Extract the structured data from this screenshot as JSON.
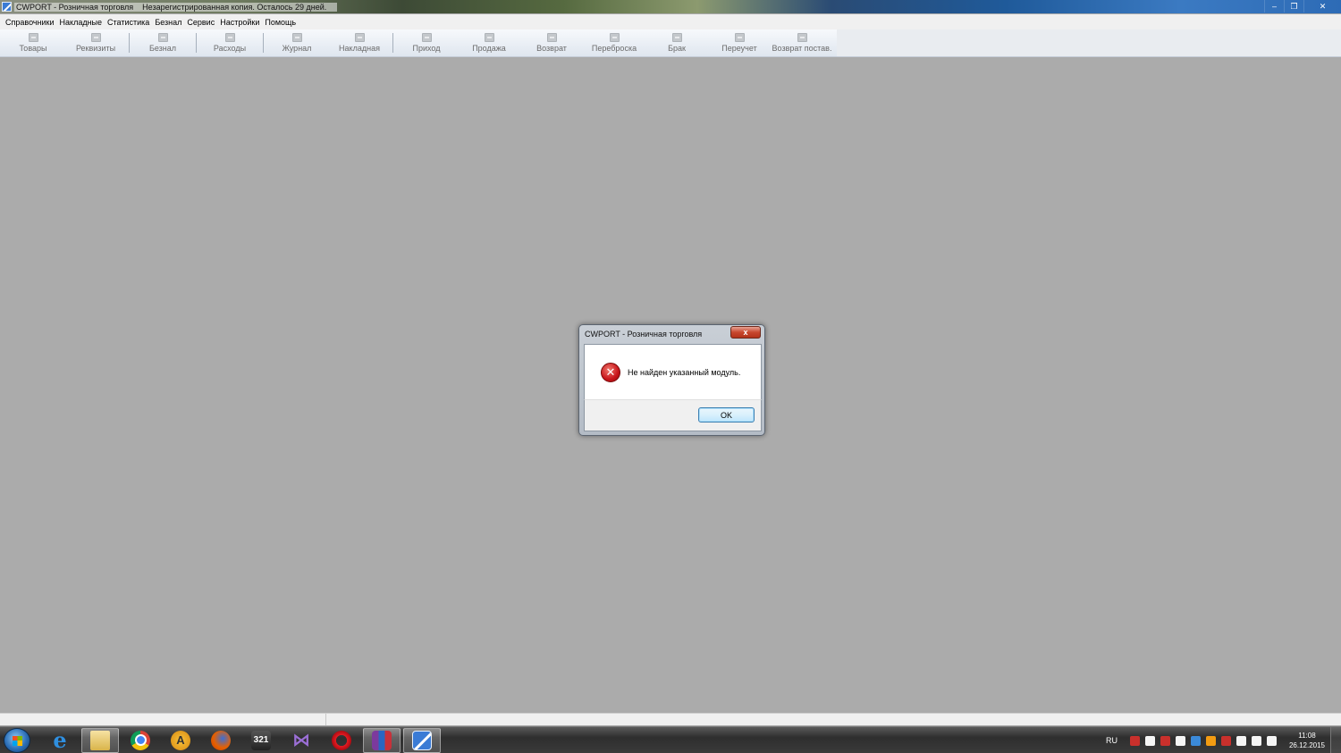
{
  "window": {
    "title": "CWPORT - Розничная торговля",
    "subtitle": "Незарегистрированная копия. Осталось  29  дней.",
    "controls": {
      "minimize": "‒",
      "restore": "❐",
      "close": "✕"
    }
  },
  "menu": {
    "items": [
      "Справочники",
      "Накладные",
      "Статистика",
      "Безнал",
      "Сервис",
      "Настройки",
      "Помощь"
    ]
  },
  "toolbar": {
    "buttons": [
      {
        "label": "Товары",
        "icon": "edit-icon"
      },
      {
        "label": "Реквизиты",
        "icon": "people-icon"
      },
      {
        "label": "Безнал",
        "icon": "card-icon"
      },
      {
        "label": "Расходы",
        "icon": "coins-icon"
      },
      {
        "label": "Журнал",
        "icon": "journal-icon"
      },
      {
        "label": "Накладная",
        "icon": "invoice-icon"
      },
      {
        "label": "Приход",
        "icon": "plus-icon"
      },
      {
        "label": "Продажа",
        "icon": "minus-icon"
      },
      {
        "label": "Возврат",
        "icon": "return-icon"
      },
      {
        "label": "Переброска",
        "icon": "transfer-icon"
      },
      {
        "label": "Брак",
        "icon": "defect-icon"
      },
      {
        "label": "Переучет",
        "icon": "check-icon"
      },
      {
        "label": "Возврат постав.",
        "icon": "supplier-return-icon"
      }
    ]
  },
  "dialog": {
    "title": "CWPORT - Розничная торговля",
    "close_glyph": "x",
    "message": "Не найден указанный модуль.",
    "error_glyph": "✕",
    "ok_label": "OK"
  },
  "taskbar": {
    "apps": [
      {
        "name": "internet-explorer",
        "glyph": "e",
        "active": false
      },
      {
        "name": "file-explorer",
        "glyph": "",
        "active": true
      },
      {
        "name": "chrome",
        "glyph": "",
        "active": false
      },
      {
        "name": "aimp",
        "glyph": "A",
        "active": false
      },
      {
        "name": "firefox",
        "glyph": "",
        "active": false
      },
      {
        "name": "media-player-321",
        "glyph": "321",
        "active": false
      },
      {
        "name": "visual-studio",
        "glyph": "⋈",
        "active": false
      },
      {
        "name": "opera",
        "glyph": "",
        "active": false
      },
      {
        "name": "winrar",
        "glyph": "",
        "active": true
      },
      {
        "name": "cwport",
        "glyph": "",
        "active": true
      }
    ],
    "tray": {
      "language": "RU",
      "time": "11:08",
      "date": "26.12.2015"
    }
  },
  "colors": {
    "workspace": "#ababab",
    "error_red": "#c8141a",
    "accent_blue": "#3a7bd5"
  }
}
